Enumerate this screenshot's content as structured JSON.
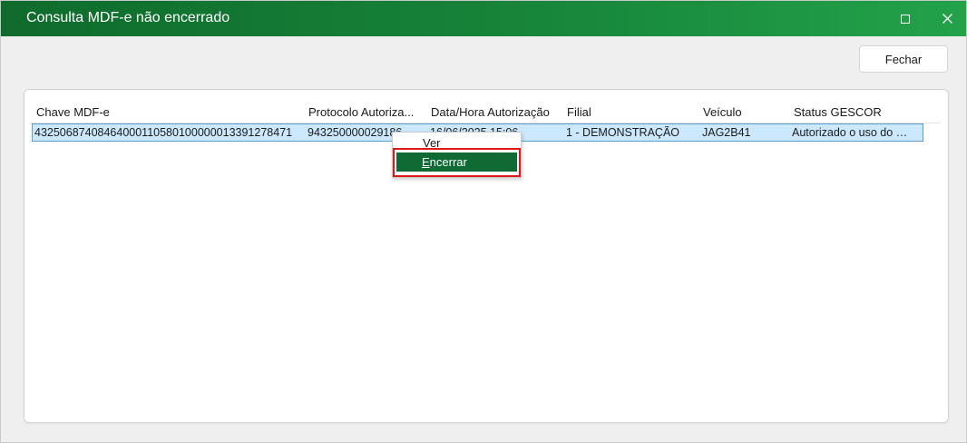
{
  "window": {
    "title": "Consulta MDF-e não encerrado",
    "maximize_icon": "maximize-icon",
    "close_icon": "close-icon"
  },
  "toolbar": {
    "close_label": "Fechar"
  },
  "table": {
    "columns": [
      "Chave MDF-e",
      "Protocolo Autoriza...",
      "Data/Hora Autorização",
      "Filial",
      "Veículo",
      "Status GESCOR"
    ],
    "rows": [
      {
        "chave": "43250687408464000110580100000013391278471",
        "protocolo": "943250000029186",
        "data_hora": "16/06/2025 15:06",
        "filial": "1 - DEMONSTRAÇÃO",
        "veiculo": "JAG2B41",
        "status": "Autorizado o uso do MDF-e"
      }
    ]
  },
  "context_menu": {
    "items": [
      {
        "label": "Ver",
        "mnemonic": ""
      },
      {
        "label": "Encerrar",
        "mnemonic": "E"
      }
    ],
    "selected_color": "#0f6b33",
    "highlight_color": "#e01818"
  },
  "colors": {
    "titlebar": "#17853a",
    "row_selected": "#cce8ff"
  }
}
